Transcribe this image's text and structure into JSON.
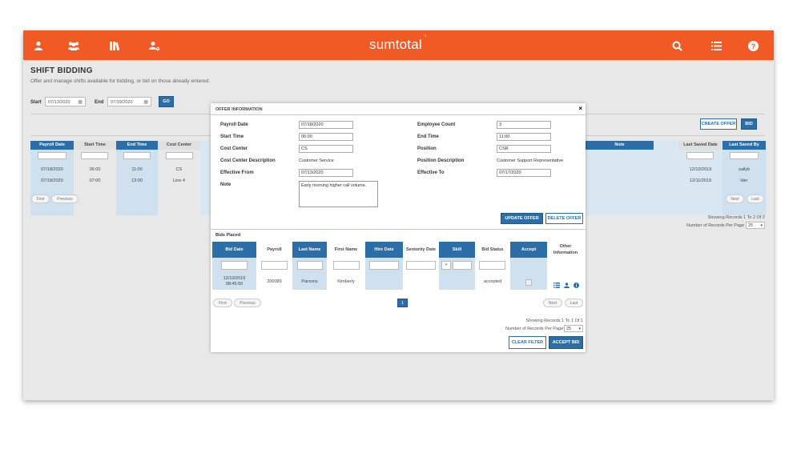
{
  "brand": "sumtotal",
  "nav_icons": [
    "user-icon",
    "group-icon",
    "library-icon",
    "user-settings-icon",
    "search-icon",
    "list-icon",
    "help-icon"
  ],
  "page": {
    "title": "SHIFT BIDDING",
    "subtitle": "Offer and manage shifts available for bidding, or bid on those already entered.",
    "start_label": "Start",
    "start_value": "07/13/2020",
    "end_label": "End",
    "end_value": "07/19/2020",
    "go_label": "GO",
    "create_offer_label": "CREATE OFFER",
    "bid_label": "BID",
    "columns": [
      "Payroll Date",
      "Start Time",
      "End Time",
      "Cost Center",
      "Note",
      "Last Saved Date",
      "Last Saved By"
    ],
    "rows": [
      {
        "payroll_date": "07/18/2020",
        "start": "06:00",
        "end": "11:00",
        "cost_center": "CS",
        "last_saved_date": "12/10/2019",
        "last_saved_by": "sallyb"
      },
      {
        "payroll_date": "07/18/2020",
        "start": "07:00",
        "end": "13:00",
        "cost_center": "Line 4",
        "last_saved_date": "12/11/2019",
        "last_saved_by": "lder"
      }
    ],
    "first_label": "First",
    "previous_label": "Previous",
    "next_label": "Next",
    "last_label": "Last",
    "showing": "Showing Records 1 To 2 Of 2",
    "per_page_label": "Number of Records Per Page",
    "per_page_value": "25"
  },
  "modal": {
    "title": "OFFER INFORMATION",
    "close": "×",
    "fields": {
      "payroll_date_label": "Payroll Date",
      "payroll_date": "07/18/2020",
      "start_time_label": "Start Time",
      "start_time": "06:00",
      "cost_center_label": "Cost Center",
      "cost_center": "CS",
      "cost_center_desc_label": "Cost Center Description",
      "cost_center_desc": "Customer Service",
      "effective_from_label": "Effective From",
      "effective_from": "07/13/2020",
      "note_label": "Note",
      "note": "Early morning higher call volume.",
      "employee_count_label": "Employee Count",
      "employee_count": "3",
      "end_time_label": "End Time",
      "end_time": "11:00",
      "position_label": "Position",
      "position": "CSR",
      "position_desc_label": "Position Description",
      "position_desc": "Customer Support Representative",
      "effective_to_label": "Effective To",
      "effective_to": "07/17/2020"
    },
    "update_offer_label": "UPDATE OFFER",
    "delete_offer_label": "DELETE OFFER",
    "bids_placed_label": "Bids Placed",
    "bid_columns": [
      "Bid Date",
      "Payroll",
      "Last Name",
      "First Name",
      "Hire Date",
      "Seniority Date",
      "Skill",
      "Bid Status",
      "Accept",
      "Other Information"
    ],
    "skill_op": ">",
    "bid_row": {
      "bid_date": "12/10/2019",
      "bid_time": "08:45:50",
      "payroll": "200089",
      "last_name": "Parsons",
      "first_name": "Kimberly",
      "bid_status": "accepted"
    },
    "first_label": "First",
    "previous_label": "Previous",
    "page_number": "1",
    "next_label": "Next",
    "last_label": "Last",
    "showing": "Showing Records 1 To 1 Of 1",
    "per_page_label": "Number of Records Per Page",
    "per_page_value": "25",
    "clear_filter_label": "CLEAR FILTER",
    "accept_bid_label": "ACCEPT BID"
  },
  "colors": {
    "brand_orange": "#f15a24",
    "primary_blue": "#2c6ea8"
  }
}
